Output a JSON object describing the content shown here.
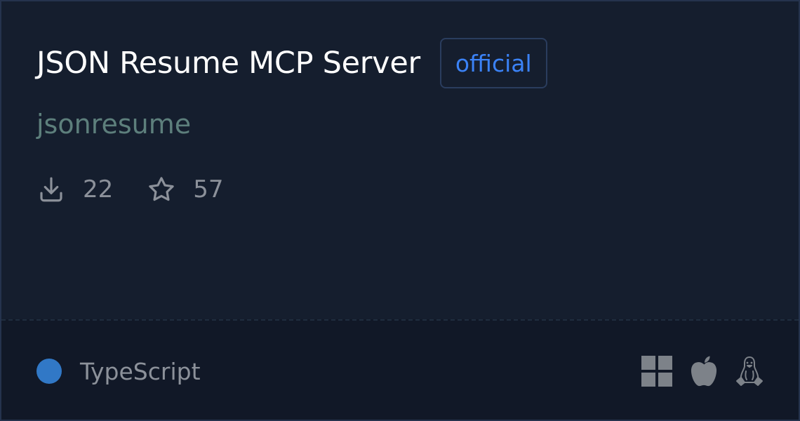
{
  "card": {
    "title": "JSON Resume MCP Server",
    "badge": "official",
    "author": "jsonresume",
    "stats": {
      "downloads": {
        "icon": "download-icon",
        "value": "22"
      },
      "stars": {
        "icon": "star-icon",
        "value": "57"
      }
    },
    "footer": {
      "language": {
        "name": "TypeScript",
        "color": "#3178c6"
      },
      "platforms": [
        "windows-icon",
        "apple-icon",
        "linux-icon"
      ]
    }
  },
  "colors": {
    "background": "#151e2e",
    "footer_background": "#111827",
    "title": "#ffffff",
    "badge": "#3b82f6",
    "author": "#5d7f7c",
    "muted": "#8c919a"
  }
}
